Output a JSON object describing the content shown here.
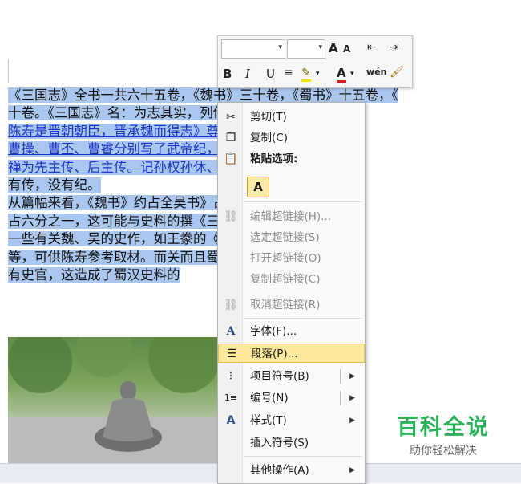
{
  "document": {
    "lines": [
      "《三国志》全书一共六十五卷，《魏书》三十卷，《蜀书》十五卷，《",
      "十卷。《三国志》名：为志其实，列传，蜀，吴二志只",
      "陈寿是晋朝朝臣，晋承魏而得志》尊魏为正统。《三",
      "曹操、曹丕、曹睿分别写了武帝纪，而《蜀书》则记",
      "禅为先主传、后主传。记孙权孙休、孙皓为三嗣主",
      "有传，没有纪。",
      "从篇幅来看，《魏书》约占全吴书》占三分之一，《",
      "占六分之一，这可能与史料的撰《三国志》以前，已",
      "一些有关魏、吴的史作，如王豢的《魏略》、韦昭的",
      "等，可供陈寿参考取材。而关而且蜀汉也不像魏、",
      "有史官，这造成了蜀汉史料的"
    ]
  },
  "mini_toolbar": {
    "grow_font": "A",
    "shrink_font": "A",
    "bold": "B",
    "italic": "I",
    "underline": "U",
    "font_color": "A",
    "phonetic": "wén"
  },
  "context_menu": {
    "items": [
      {
        "label": "剪切(T)",
        "icon": "scissors-icon",
        "enabled": true
      },
      {
        "label": "复制(C)",
        "icon": "copy-icon",
        "enabled": true
      },
      {
        "label": "粘贴选项:",
        "icon": "paste-icon",
        "enabled": true
      },
      {
        "label": "A",
        "icon": "paste-text-only-icon",
        "enabled": true
      },
      {
        "label": "编辑超链接(H)...",
        "icon": "edit-hyperlink-icon",
        "enabled": false
      },
      {
        "label": "选定超链接(S)",
        "icon": "",
        "enabled": false
      },
      {
        "label": "打开超链接(O)",
        "icon": "",
        "enabled": false
      },
      {
        "label": "复制超链接(C)",
        "icon": "",
        "enabled": false
      },
      {
        "label": "取消超链接(R)",
        "icon": "remove-hyperlink-icon",
        "enabled": false
      },
      {
        "label": "字体(F)...",
        "icon": "font-icon",
        "enabled": true
      },
      {
        "label": "段落(P)...",
        "icon": "paragraph-icon",
        "enabled": true,
        "highlighted": true
      },
      {
        "label": "项目符号(B)",
        "icon": "bullets-icon",
        "enabled": true
      },
      {
        "label": "编号(N)",
        "icon": "numbering-icon",
        "enabled": true
      },
      {
        "label": "样式(T)",
        "icon": "styles-icon",
        "enabled": true
      },
      {
        "label": "插入符号(S)",
        "icon": "",
        "enabled": true
      },
      {
        "label": "其他操作(A)",
        "icon": "",
        "enabled": true
      }
    ],
    "highlight_color": "#fde99c"
  },
  "watermark": {
    "title": "百科全说",
    "subtitle": "助你轻松解决",
    "color": "#2cb35a"
  },
  "selection_color": "#a9c7ef",
  "link_color": "#1a35c7"
}
